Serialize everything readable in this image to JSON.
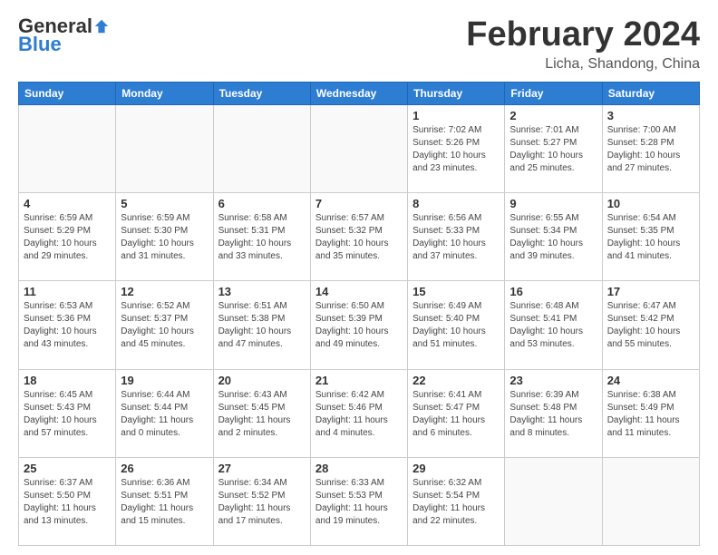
{
  "logo": {
    "general": "General",
    "blue": "Blue"
  },
  "header": {
    "month": "February 2024",
    "location": "Licha, Shandong, China"
  },
  "weekdays": [
    "Sunday",
    "Monday",
    "Tuesday",
    "Wednesday",
    "Thursday",
    "Friday",
    "Saturday"
  ],
  "weeks": [
    [
      {
        "day": "",
        "detail": ""
      },
      {
        "day": "",
        "detail": ""
      },
      {
        "day": "",
        "detail": ""
      },
      {
        "day": "",
        "detail": ""
      },
      {
        "day": "1",
        "detail": "Sunrise: 7:02 AM\nSunset: 5:26 PM\nDaylight: 10 hours\nand 23 minutes."
      },
      {
        "day": "2",
        "detail": "Sunrise: 7:01 AM\nSunset: 5:27 PM\nDaylight: 10 hours\nand 25 minutes."
      },
      {
        "day": "3",
        "detail": "Sunrise: 7:00 AM\nSunset: 5:28 PM\nDaylight: 10 hours\nand 27 minutes."
      }
    ],
    [
      {
        "day": "4",
        "detail": "Sunrise: 6:59 AM\nSunset: 5:29 PM\nDaylight: 10 hours\nand 29 minutes."
      },
      {
        "day": "5",
        "detail": "Sunrise: 6:59 AM\nSunset: 5:30 PM\nDaylight: 10 hours\nand 31 minutes."
      },
      {
        "day": "6",
        "detail": "Sunrise: 6:58 AM\nSunset: 5:31 PM\nDaylight: 10 hours\nand 33 minutes."
      },
      {
        "day": "7",
        "detail": "Sunrise: 6:57 AM\nSunset: 5:32 PM\nDaylight: 10 hours\nand 35 minutes."
      },
      {
        "day": "8",
        "detail": "Sunrise: 6:56 AM\nSunset: 5:33 PM\nDaylight: 10 hours\nand 37 minutes."
      },
      {
        "day": "9",
        "detail": "Sunrise: 6:55 AM\nSunset: 5:34 PM\nDaylight: 10 hours\nand 39 minutes."
      },
      {
        "day": "10",
        "detail": "Sunrise: 6:54 AM\nSunset: 5:35 PM\nDaylight: 10 hours\nand 41 minutes."
      }
    ],
    [
      {
        "day": "11",
        "detail": "Sunrise: 6:53 AM\nSunset: 5:36 PM\nDaylight: 10 hours\nand 43 minutes."
      },
      {
        "day": "12",
        "detail": "Sunrise: 6:52 AM\nSunset: 5:37 PM\nDaylight: 10 hours\nand 45 minutes."
      },
      {
        "day": "13",
        "detail": "Sunrise: 6:51 AM\nSunset: 5:38 PM\nDaylight: 10 hours\nand 47 minutes."
      },
      {
        "day": "14",
        "detail": "Sunrise: 6:50 AM\nSunset: 5:39 PM\nDaylight: 10 hours\nand 49 minutes."
      },
      {
        "day": "15",
        "detail": "Sunrise: 6:49 AM\nSunset: 5:40 PM\nDaylight: 10 hours\nand 51 minutes."
      },
      {
        "day": "16",
        "detail": "Sunrise: 6:48 AM\nSunset: 5:41 PM\nDaylight: 10 hours\nand 53 minutes."
      },
      {
        "day": "17",
        "detail": "Sunrise: 6:47 AM\nSunset: 5:42 PM\nDaylight: 10 hours\nand 55 minutes."
      }
    ],
    [
      {
        "day": "18",
        "detail": "Sunrise: 6:45 AM\nSunset: 5:43 PM\nDaylight: 10 hours\nand 57 minutes."
      },
      {
        "day": "19",
        "detail": "Sunrise: 6:44 AM\nSunset: 5:44 PM\nDaylight: 11 hours\nand 0 minutes."
      },
      {
        "day": "20",
        "detail": "Sunrise: 6:43 AM\nSunset: 5:45 PM\nDaylight: 11 hours\nand 2 minutes."
      },
      {
        "day": "21",
        "detail": "Sunrise: 6:42 AM\nSunset: 5:46 PM\nDaylight: 11 hours\nand 4 minutes."
      },
      {
        "day": "22",
        "detail": "Sunrise: 6:41 AM\nSunset: 5:47 PM\nDaylight: 11 hours\nand 6 minutes."
      },
      {
        "day": "23",
        "detail": "Sunrise: 6:39 AM\nSunset: 5:48 PM\nDaylight: 11 hours\nand 8 minutes."
      },
      {
        "day": "24",
        "detail": "Sunrise: 6:38 AM\nSunset: 5:49 PM\nDaylight: 11 hours\nand 11 minutes."
      }
    ],
    [
      {
        "day": "25",
        "detail": "Sunrise: 6:37 AM\nSunset: 5:50 PM\nDaylight: 11 hours\nand 13 minutes."
      },
      {
        "day": "26",
        "detail": "Sunrise: 6:36 AM\nSunset: 5:51 PM\nDaylight: 11 hours\nand 15 minutes."
      },
      {
        "day": "27",
        "detail": "Sunrise: 6:34 AM\nSunset: 5:52 PM\nDaylight: 11 hours\nand 17 minutes."
      },
      {
        "day": "28",
        "detail": "Sunrise: 6:33 AM\nSunset: 5:53 PM\nDaylight: 11 hours\nand 19 minutes."
      },
      {
        "day": "29",
        "detail": "Sunrise: 6:32 AM\nSunset: 5:54 PM\nDaylight: 11 hours\nand 22 minutes."
      },
      {
        "day": "",
        "detail": ""
      },
      {
        "day": "",
        "detail": ""
      }
    ]
  ]
}
